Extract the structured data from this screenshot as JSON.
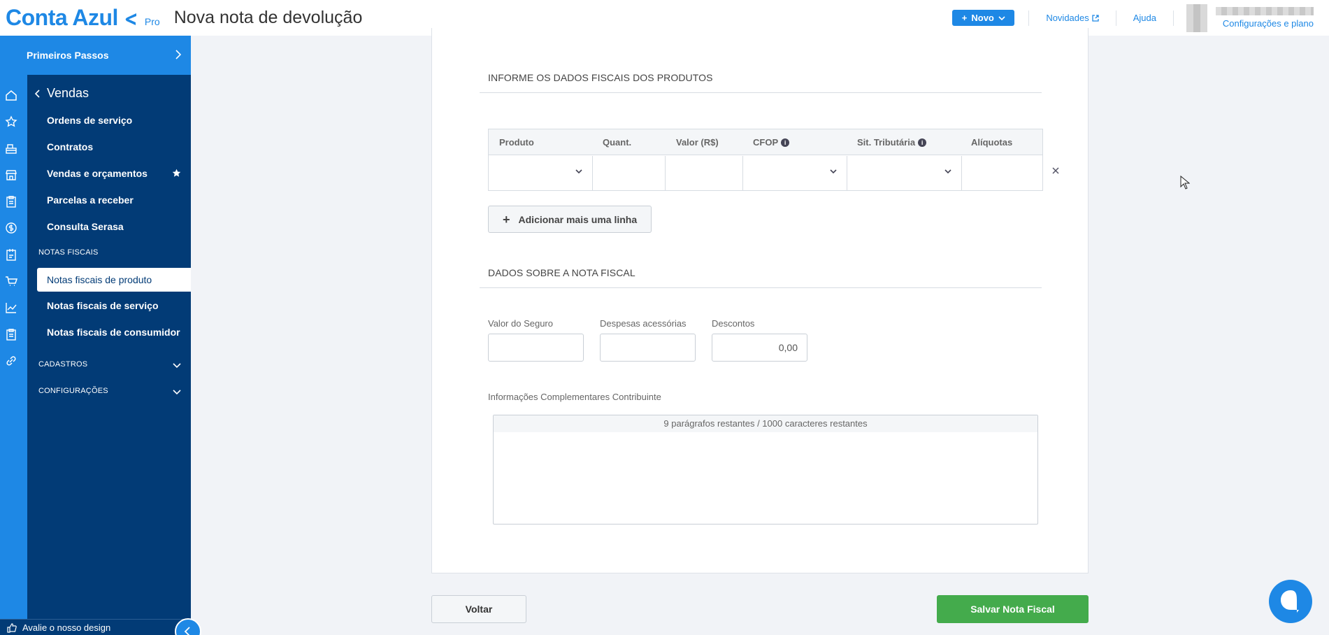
{
  "header": {
    "logo_text": "Conta Azul",
    "logo_badge": "Pro",
    "page_title": "Nova nota de devolução",
    "new_button": "Novo",
    "links": {
      "news": "Novidades",
      "help": "Ajuda"
    },
    "user_subtitle": "Configurações e plano"
  },
  "sidebar": {
    "first_steps": "Primeiros Passos",
    "section": "Vendas",
    "items": [
      "Ordens de serviço",
      "Contratos",
      "Vendas e orçamentos",
      "Parcelas a receber",
      "Consulta Serasa"
    ],
    "group_fiscal": "NOTAS FISCAIS",
    "fiscal_items": [
      "Notas fiscais de produto",
      "Notas fiscais de serviço",
      "Notas fiscais de consumidor"
    ],
    "group_cadastros": "CADASTROS",
    "group_config": "CONFIGURAÇÕES",
    "feedback": "Avalie o nosso design",
    "rail_icons": [
      "home-icon",
      "star-icon",
      "cash-register-icon",
      "store-icon",
      "clipboard-icon",
      "dollar-icon",
      "invoice-icon",
      "cart-icon",
      "chart-icon",
      "document-icon",
      "link-icon"
    ]
  },
  "form": {
    "products_section": "INFORME OS DADOS FISCAIS DOS PRODUTOS",
    "columns": [
      "Produto",
      "Quant.",
      "Valor (R$)",
      "CFOP",
      "Sit. Tributária",
      "Alíquotas"
    ],
    "add_line": "Adicionar mais uma linha",
    "invoice_section": "DADOS SOBRE A NOTA FISCAL",
    "insurance_label": "Valor do Seguro",
    "insurance_value": "",
    "expenses_label": "Despesas acessórias",
    "expenses_value": "",
    "discount_label": "Descontos",
    "discount_value": "0,00",
    "info_label": "Informações Complementares Contribuinte",
    "info_counter": "9 parágrafos restantes / 1000 caracteres restantes"
  },
  "actions": {
    "back": "Voltar",
    "save": "Salvar Nota Fiscal"
  }
}
